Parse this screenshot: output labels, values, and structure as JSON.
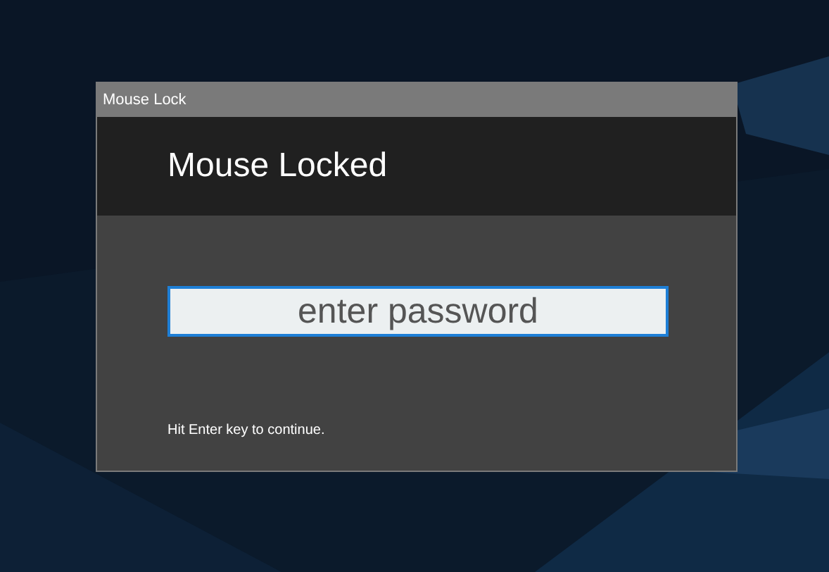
{
  "window": {
    "title": "Mouse Lock",
    "heading": "Mouse Locked",
    "password_field": {
      "placeholder": "enter password",
      "focused": true
    },
    "hint": "Hit Enter key to continue."
  }
}
